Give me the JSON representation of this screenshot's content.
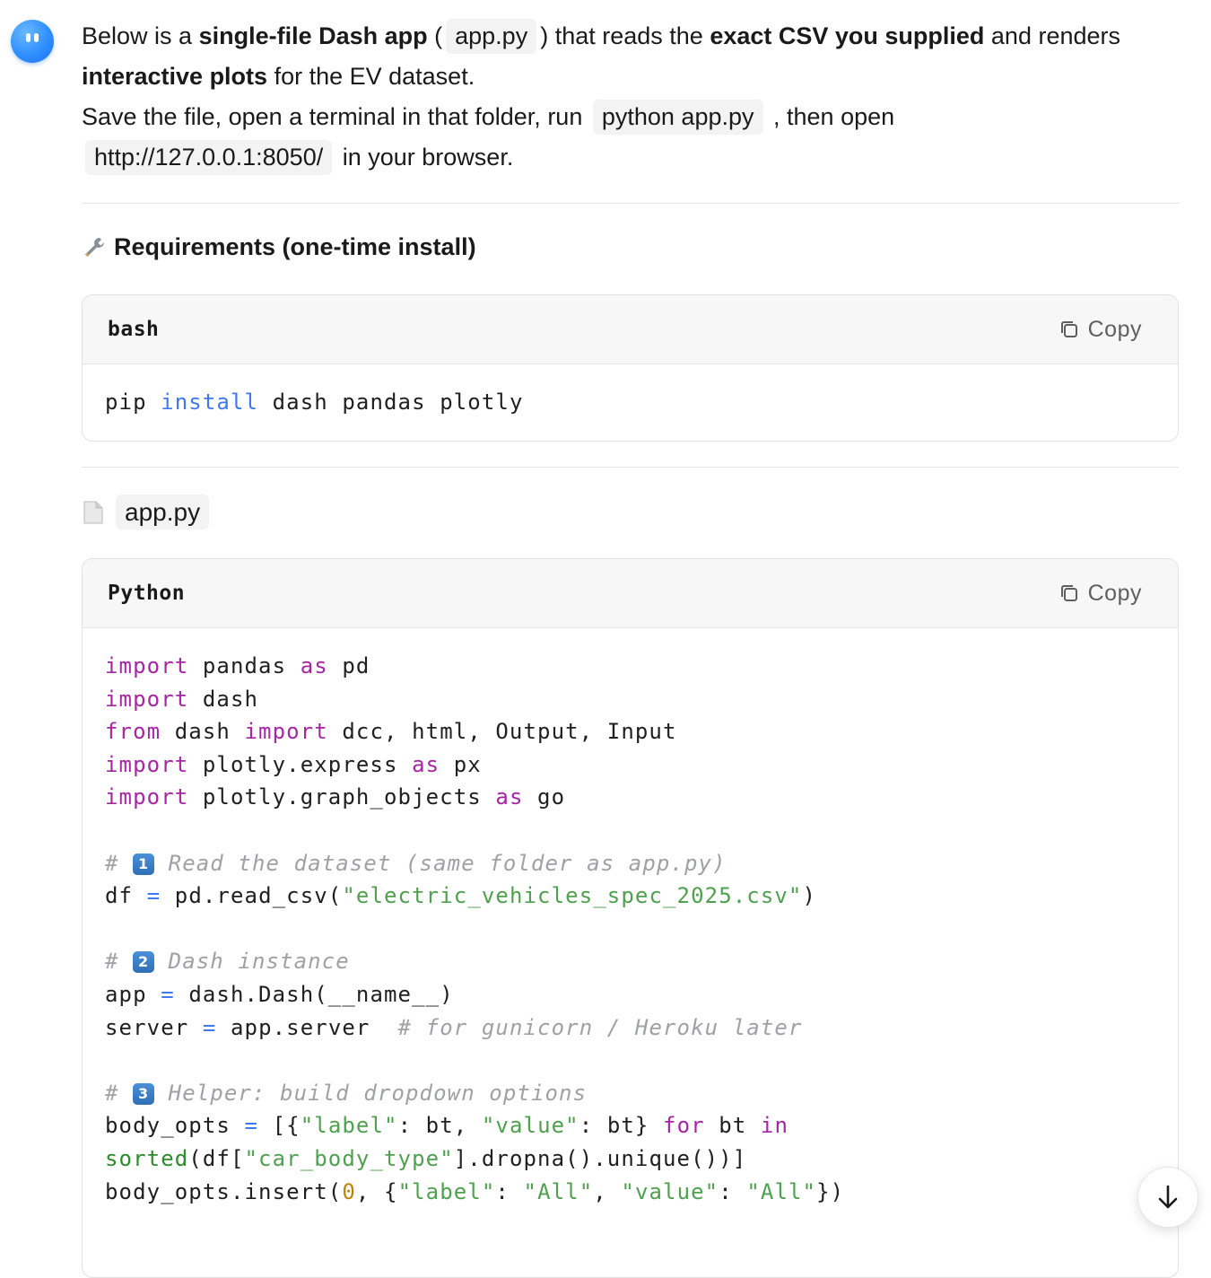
{
  "intro": {
    "s1": "Below is a ",
    "b1": "single-file Dash app",
    "s2": " (",
    "code1": "app.py",
    "s3": ") that reads the ",
    "b2": "exact CSV you supplied",
    "s4": " and renders ",
    "b3": "interactive plots",
    "s5": " for the EV dataset.",
    "l2_s1": "Save the file, open a terminal in that folder, run",
    "code2": "python app.py",
    "l2_s2": ", then open",
    "code3": "http://127.0.0.1:8050/",
    "l2_s3": "in your browser."
  },
  "requirements": {
    "title": "Requirements (one-time install)",
    "lang": "bash",
    "copy_label": "Copy"
  },
  "file": {
    "name": "app.py",
    "lang": "Python",
    "copy_label": "Copy"
  },
  "colors": {
    "accent": "#2f8fff",
    "keyword": "#a626a4",
    "string": "#50a14f",
    "operator": "#4078f2",
    "comment": "#a0a1a7"
  }
}
